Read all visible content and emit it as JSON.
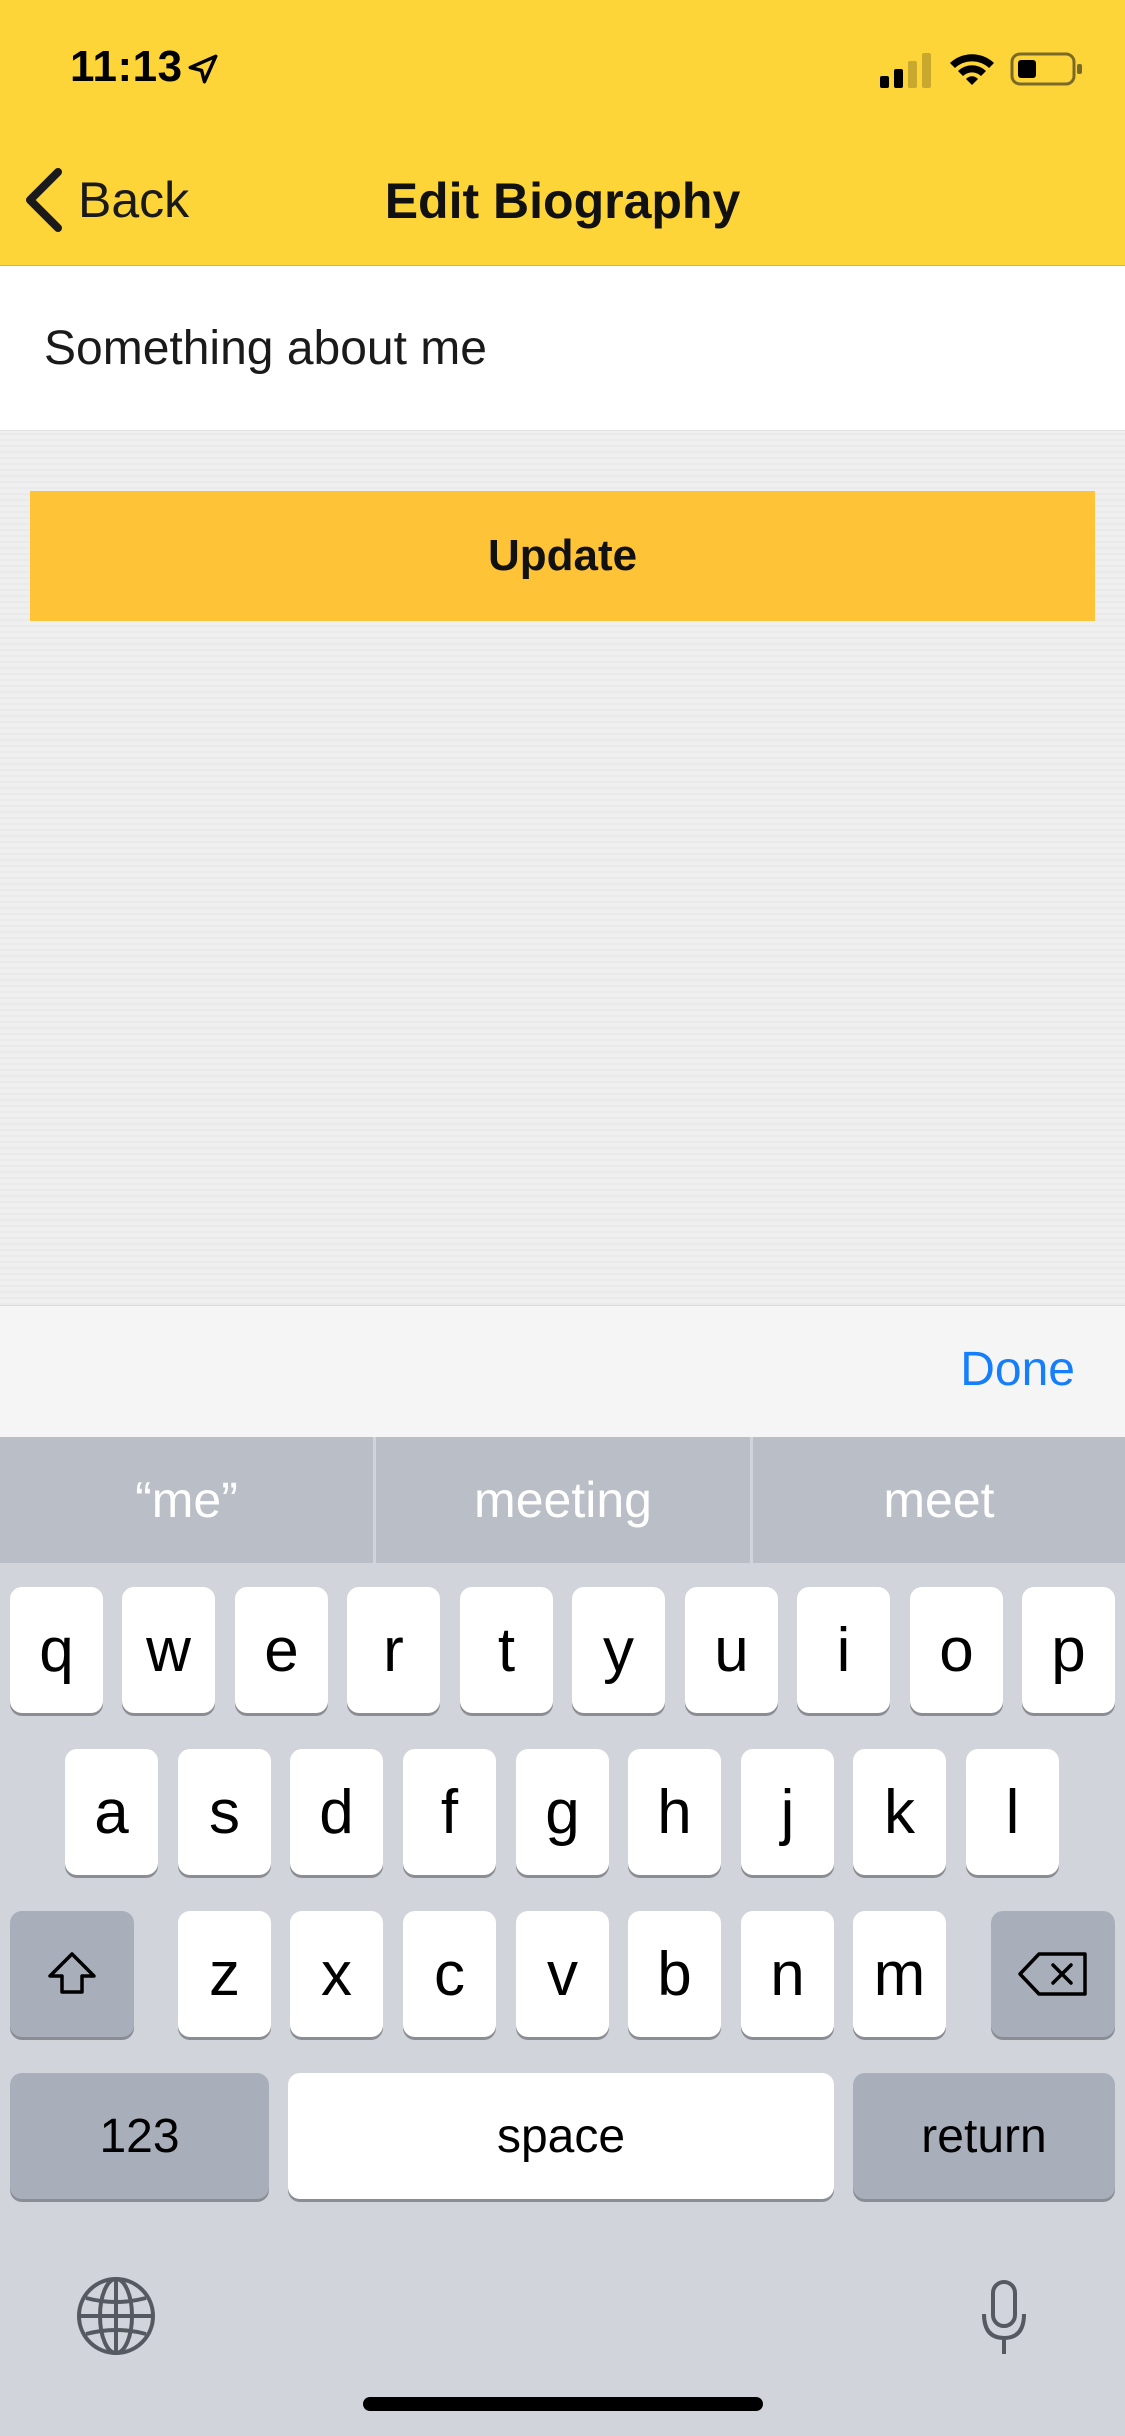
{
  "status_bar": {
    "time": "11:13"
  },
  "nav": {
    "back_label": "Back",
    "title": "Edit Biography"
  },
  "bio": {
    "value": "Something about me",
    "placeholder": ""
  },
  "update_button": {
    "label": "Update"
  },
  "accessory": {
    "done_label": "Done"
  },
  "predictions": [
    "“me”",
    "meeting",
    "meet"
  ],
  "keyboard": {
    "row1": [
      "q",
      "w",
      "e",
      "r",
      "t",
      "y",
      "u",
      "i",
      "o",
      "p"
    ],
    "row2": [
      "a",
      "s",
      "d",
      "f",
      "g",
      "h",
      "j",
      "k",
      "l"
    ],
    "row3": [
      "z",
      "x",
      "c",
      "v",
      "b",
      "n",
      "m"
    ],
    "numbers_label": "123",
    "space_label": "space",
    "return_label": "return"
  },
  "colors": {
    "header_bg": "#fdd538",
    "update_button_bg": "#fec337",
    "done_text": "#157efb",
    "caret": "#3b63e6"
  },
  "icons": {
    "location": "location-arrow-icon",
    "signal": "cellular-signal-icon",
    "wifi": "wifi-icon",
    "battery": "battery-icon",
    "back": "chevron-left-icon",
    "shift": "shift-icon",
    "delete": "delete-backspace-icon",
    "globe": "globe-icon",
    "mic": "microphone-icon"
  }
}
